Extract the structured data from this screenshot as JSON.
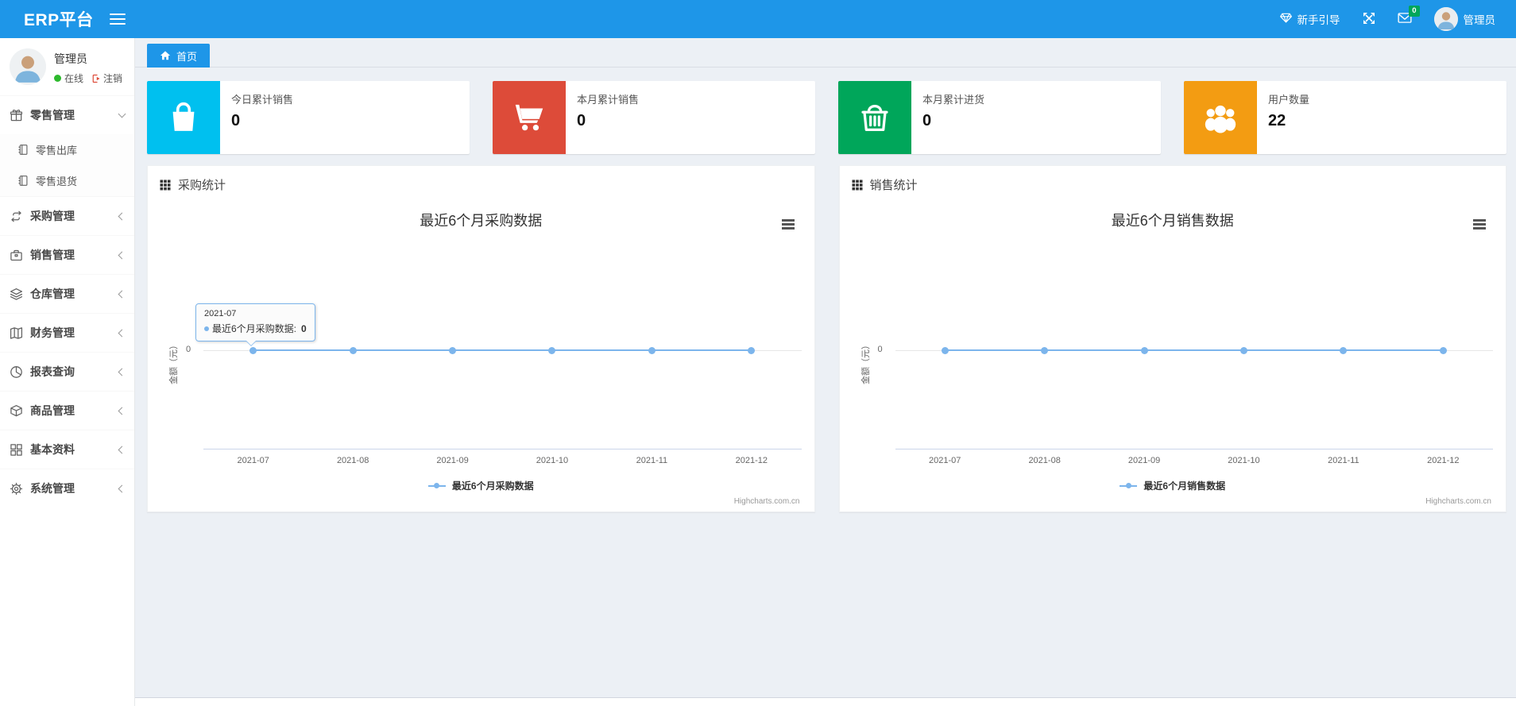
{
  "navbar": {
    "brand": "ERP平台",
    "guide_label": "新手引导",
    "messages_badge": "0",
    "user_name": "管理员"
  },
  "sidebar": {
    "user_name": "管理员",
    "user_status": "在线",
    "logout_label": "注销",
    "menu": [
      {
        "label": "零售管理"
      },
      {
        "label": "零售出库"
      },
      {
        "label": "零售退货"
      },
      {
        "label": "采购管理"
      },
      {
        "label": "销售管理"
      },
      {
        "label": "仓库管理"
      },
      {
        "label": "财务管理"
      },
      {
        "label": "报表查询"
      },
      {
        "label": "商品管理"
      },
      {
        "label": "基本资料"
      },
      {
        "label": "系统管理"
      }
    ]
  },
  "tabs": {
    "home_label": "首页"
  },
  "stat_cards": [
    {
      "label": "今日累计销售",
      "value": "0",
      "color": "#00c0ef",
      "icon": "bag-icon"
    },
    {
      "label": "本月累计销售",
      "value": "0",
      "color": "#dd4b39",
      "icon": "cart-icon"
    },
    {
      "label": "本月累计进货",
      "value": "0",
      "color": "#00a65a",
      "icon": "basket-icon"
    },
    {
      "label": "用户数量",
      "value": "22",
      "color": "#f39c12",
      "icon": "users-icon"
    }
  ],
  "panels": [
    {
      "header": "采购统计"
    },
    {
      "header": "销售统计"
    }
  ],
  "chart_data": [
    {
      "type": "line",
      "title": "最近6个月采购数据",
      "x": [
        "2021-07",
        "2021-08",
        "2021-09",
        "2021-10",
        "2021-11",
        "2021-12"
      ],
      "series": [
        {
          "name": "最近6个月采购数据",
          "values": [
            0,
            0,
            0,
            0,
            0,
            0
          ],
          "color": "#7cb5ec"
        }
      ],
      "ylabel": "金额（元）",
      "ytick": "0",
      "legend_position": "bottom",
      "grid": false,
      "tooltip": {
        "category": "2021-07",
        "label": "最近6个月采购数据:",
        "value": "0"
      },
      "credit": "Highcharts.com.cn"
    },
    {
      "type": "line",
      "title": "最近6个月销售数据",
      "x": [
        "2021-07",
        "2021-08",
        "2021-09",
        "2021-10",
        "2021-11",
        "2021-12"
      ],
      "series": [
        {
          "name": "最近6个月销售数据",
          "values": [
            0,
            0,
            0,
            0,
            0,
            0
          ],
          "color": "#7cb5ec"
        }
      ],
      "ylabel": "金额（元）",
      "ytick": "0",
      "legend_position": "bottom",
      "grid": false,
      "credit": "Highcharts.com.cn"
    }
  ],
  "colors": {
    "accent": "#1e96e8",
    "chart_line": "#7cb5ec",
    "card_cyan": "#00c0ef",
    "card_red": "#dd4b39",
    "card_green": "#00a65a",
    "card_orange": "#f39c12",
    "badge_green": "#00a65a"
  }
}
